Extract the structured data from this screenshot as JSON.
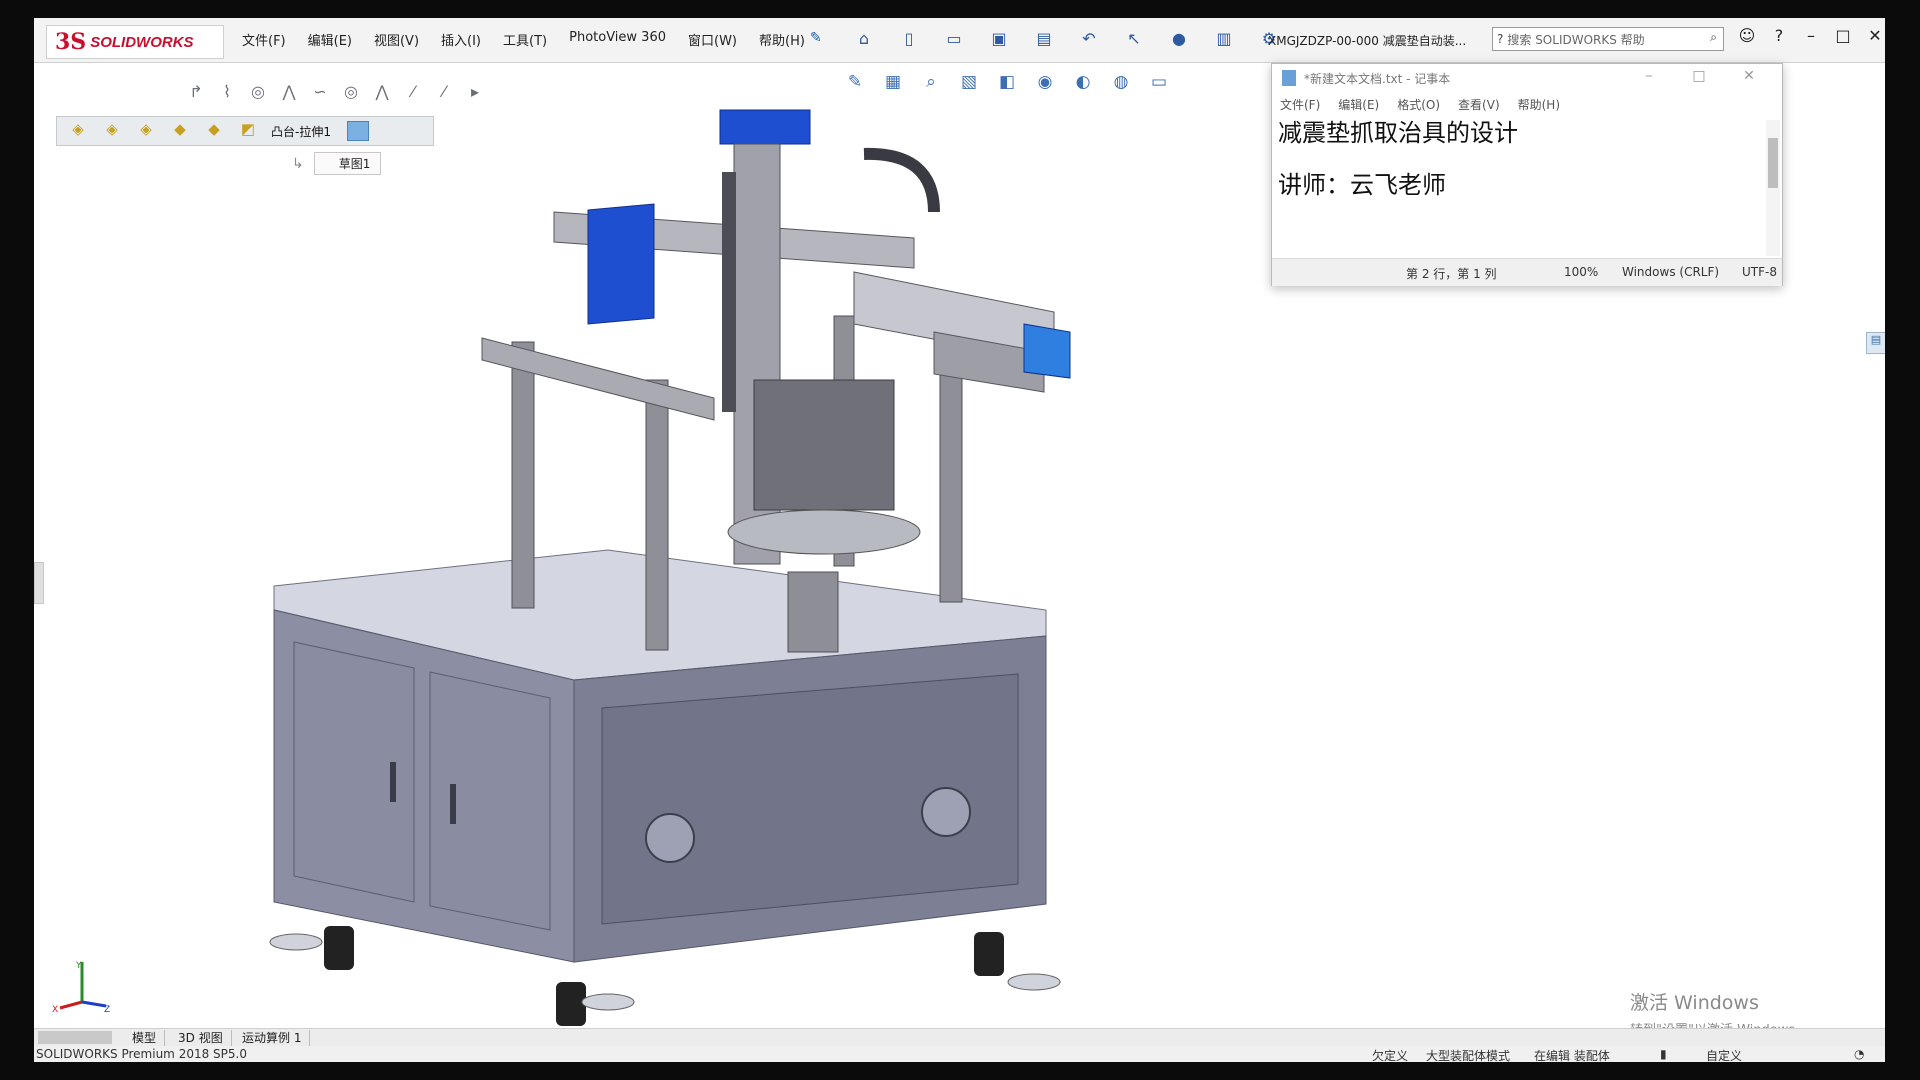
{
  "app": {
    "logo_mark": "3S",
    "logo_text": "SOLIDWORKS",
    "document_title": "XMGJZDZP-00-000 减震垫自动装..."
  },
  "menu": [
    "文件(F)",
    "编辑(E)",
    "视图(V)",
    "插入(I)",
    "工具(T)",
    "PhotoView 360",
    "窗口(W)",
    "帮助(H)"
  ],
  "search": {
    "placeholder": "搜索 SOLIDWORKS 帮助"
  },
  "feature_tree": {
    "current_feature": "凸台-拉伸1",
    "sketch": "草图1"
  },
  "notepad": {
    "title": "*新建文本文档.txt - 记事本",
    "menu": [
      "文件(F)",
      "编辑(E)",
      "格式(O)",
      "查看(V)",
      "帮助(H)"
    ],
    "lines": [
      "减震垫抓取治具的设计",
      "讲师：云飞老师"
    ],
    "status": {
      "position": "第 2 行，第 1 列",
      "zoom": "100%",
      "line_ending": "Windows (CRLF)",
      "encoding": "UTF-8"
    }
  },
  "watermark": {
    "line1": "激活 Windows",
    "line2": "转到\"设置\"以激活 Windows。"
  },
  "tabs": [
    "模型",
    "3D 视图",
    "运动算例 1"
  ],
  "statusbar": {
    "product": "SOLIDWORKS Premium 2018 SP5.0",
    "undefined": "欠定义",
    "mode": "大型装配体模式",
    "editing": "在编辑 装配体",
    "custom": "自定义"
  },
  "triad_axes": {
    "y": "Y",
    "x": "X",
    "z": "Z"
  },
  "colors": {
    "accent_blue": "#1f4fd1",
    "machine_gray": "#7d7f93",
    "frame_gray": "#9a9aa0",
    "logo_red": "#c8102e"
  }
}
